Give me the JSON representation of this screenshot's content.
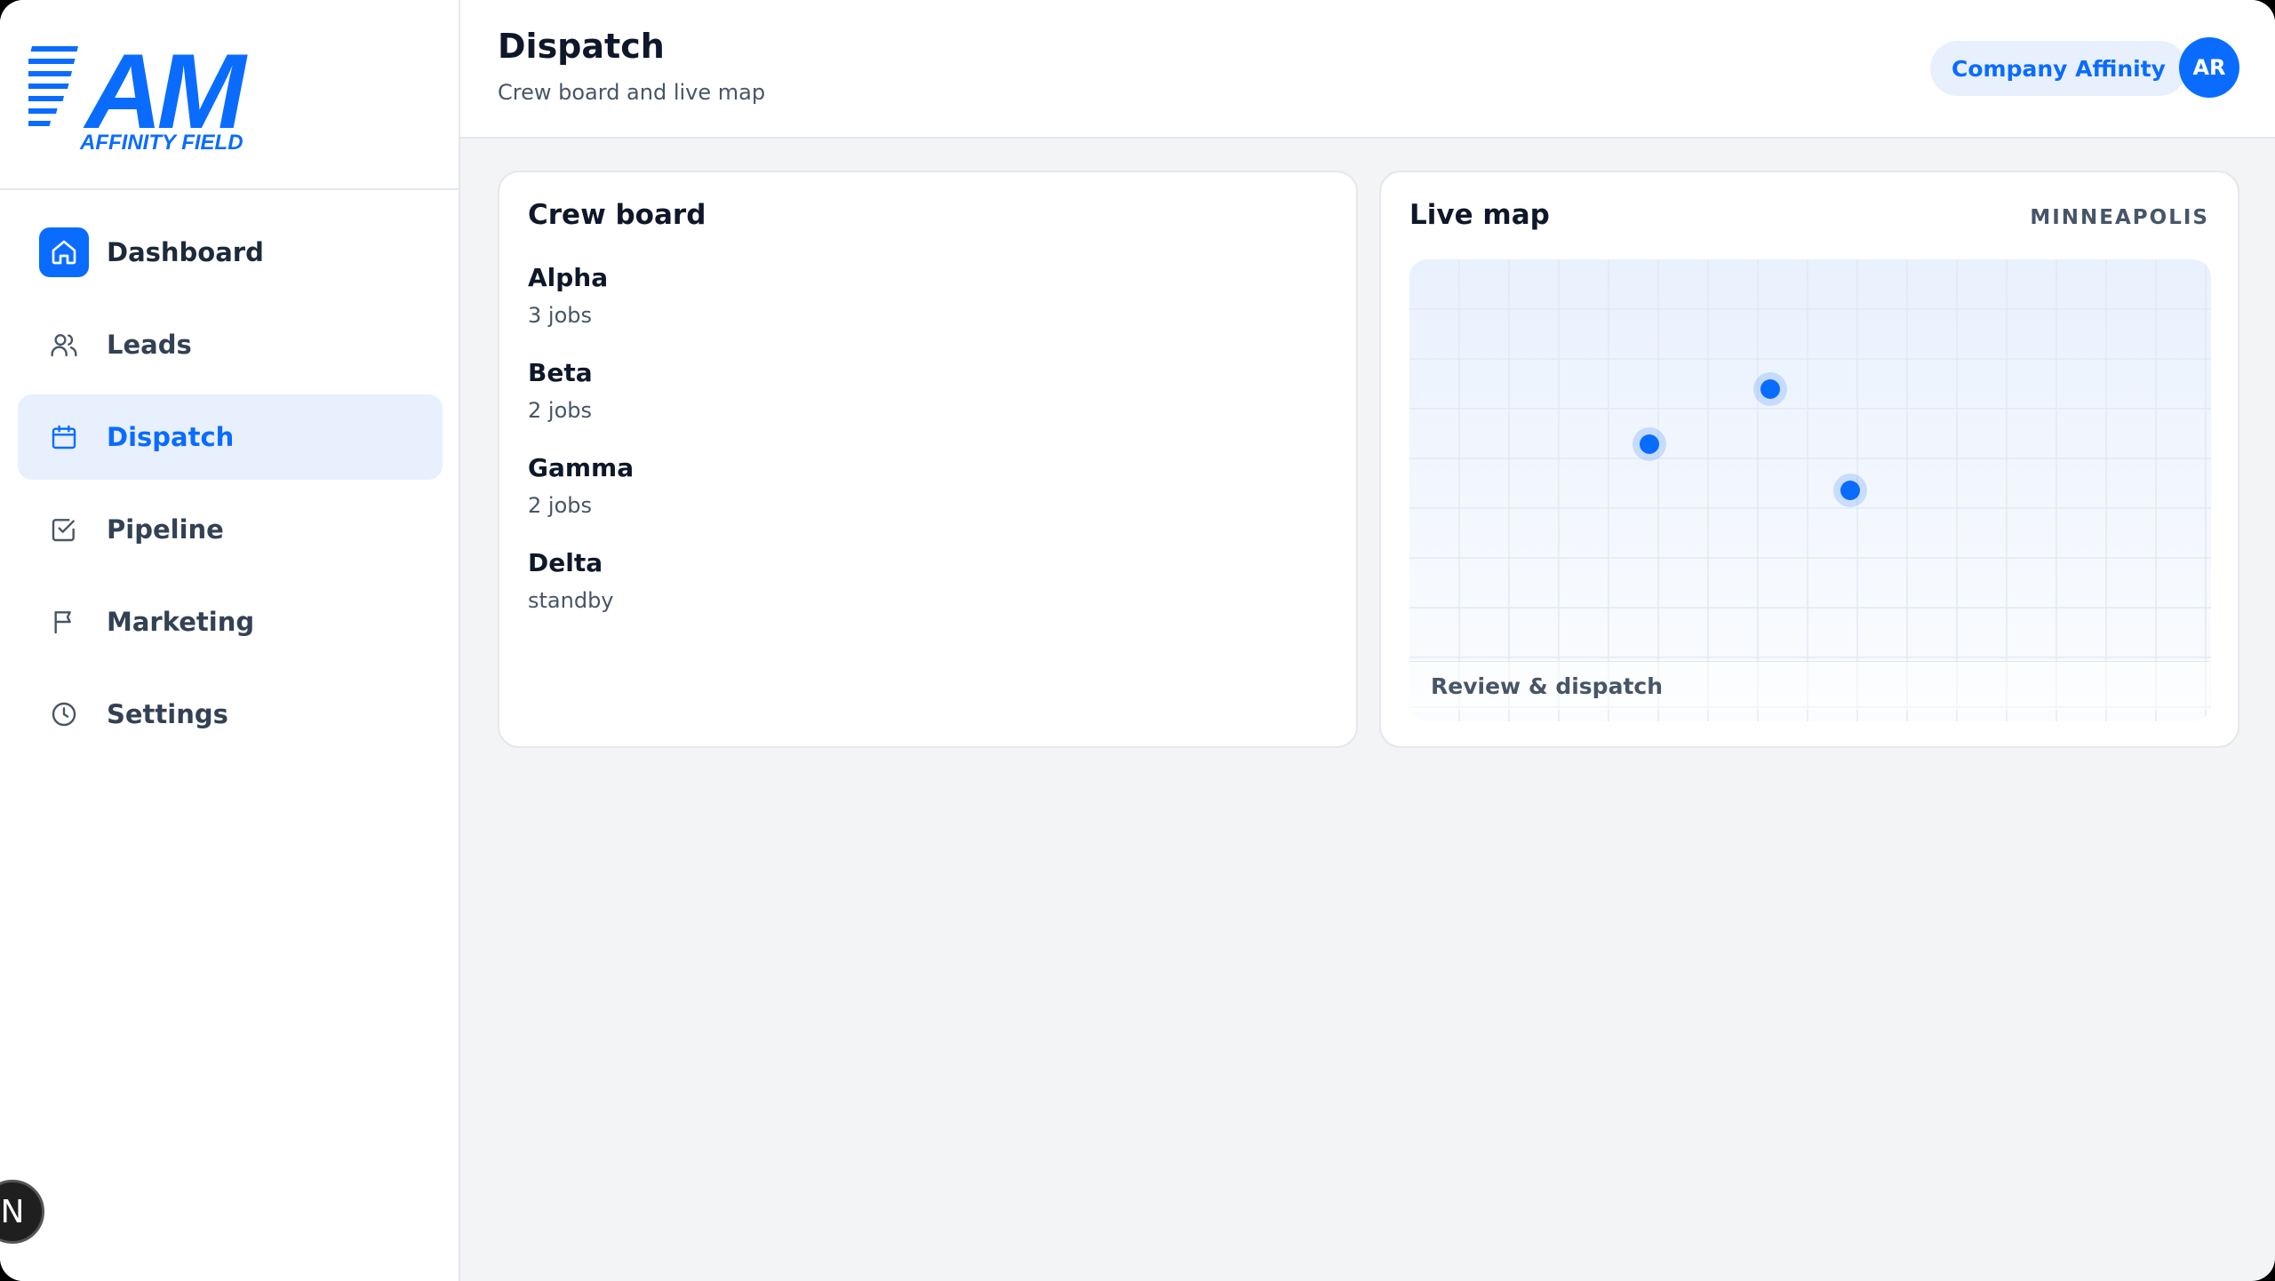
{
  "brand": {
    "logo_letters": "AM",
    "logo_tagline": "AFFINITY FIELD",
    "color": "#0a6cff"
  },
  "sidebar": {
    "items": [
      {
        "label": "Dashboard",
        "icon": "home-icon"
      },
      {
        "label": "Leads",
        "icon": "users-icon"
      },
      {
        "label": "Dispatch",
        "icon": "calendar-icon",
        "active": true
      },
      {
        "label": "Pipeline",
        "icon": "checkbox-icon"
      },
      {
        "label": "Marketing",
        "icon": "flag-icon"
      },
      {
        "label": "Settings",
        "icon": "clock-icon"
      }
    ],
    "badge": "N"
  },
  "header": {
    "title": "Dispatch",
    "subtitle": "Crew board and live map",
    "company": "Company Affinity",
    "avatar": "AR"
  },
  "crew_board": {
    "title": "Crew board",
    "crews": [
      {
        "name": "Alpha",
        "status": "3 jobs"
      },
      {
        "name": "Beta",
        "status": "2 jobs"
      },
      {
        "name": "Gamma",
        "status": "2 jobs"
      },
      {
        "name": "Delta",
        "status": "standby"
      }
    ]
  },
  "live_map": {
    "title": "Live map",
    "city": "MINNEAPOLIS",
    "action": "Review & dispatch",
    "pin_color": "#0a6cff"
  }
}
